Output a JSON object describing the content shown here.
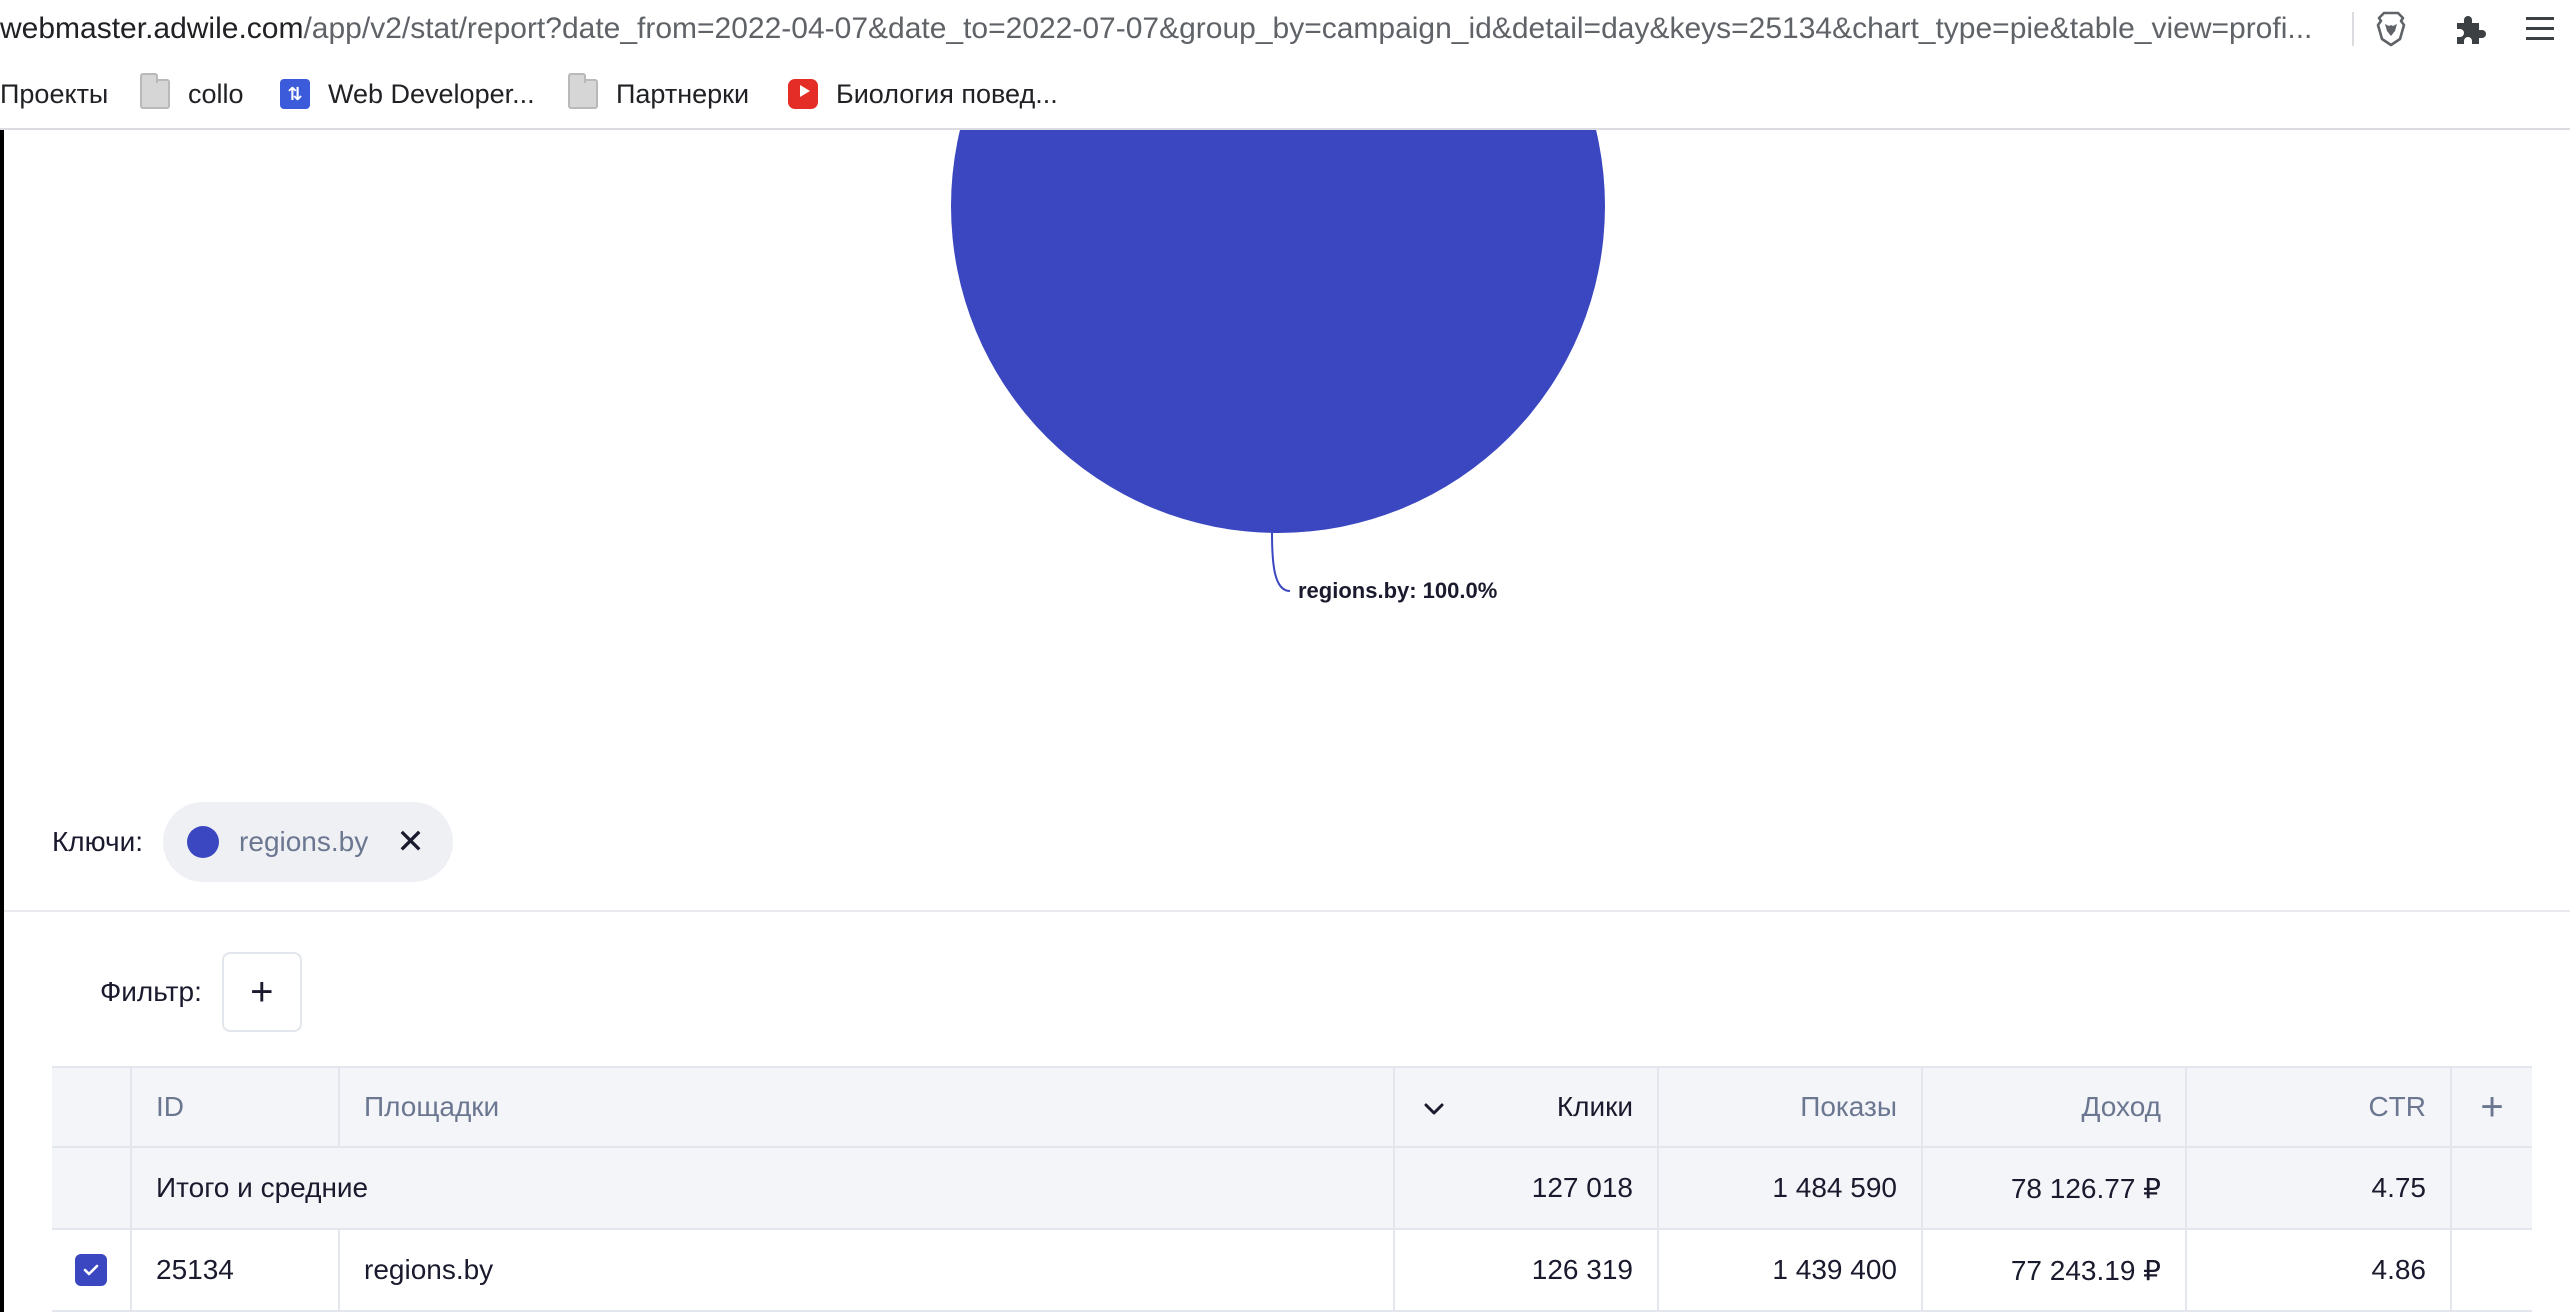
{
  "browser": {
    "url_host": "webmaster.adwile.com",
    "url_path": "/app/v2/stat/report?date_from=2022-04-07&date_to=2022-07-07&group_by=campaign_id&detail=day&keys=25134&chart_type=pie&table_view=profi...",
    "bookmarks": [
      {
        "label": "Проекты",
        "icon": "none"
      },
      {
        "label": "collo",
        "icon": "folder-icon"
      },
      {
        "label": "Web Developer...",
        "icon": "web-developer-icon"
      },
      {
        "label": "Партнерки",
        "icon": "folder-icon"
      },
      {
        "label": "Биология повед...",
        "icon": "youtube-icon"
      }
    ]
  },
  "chart_data": {
    "type": "pie",
    "slices": [
      {
        "label": "regions.by",
        "value": 100.0,
        "color": "#3b47c0"
      }
    ],
    "data_label": "regions.by: 100.0%"
  },
  "keys": {
    "label": "Ключи:",
    "chips": [
      {
        "label": "regions.by",
        "color": "#3b47c0"
      }
    ]
  },
  "filter": {
    "label": "Фильтр:",
    "add_label": "+"
  },
  "table": {
    "headers": {
      "id": "ID",
      "site": "Площадки",
      "clicks": "Клики",
      "shows": "Показы",
      "income": "Доход",
      "ctr": "CTR",
      "add": "+"
    },
    "total": {
      "label": "Итого и средние",
      "clicks": "127 018",
      "shows": "1 484 590",
      "income": "78 126.77 ₽",
      "ctr": "4.75"
    },
    "rows": [
      {
        "checked": true,
        "id": "25134",
        "site": "regions.by",
        "clicks": "126 319",
        "shows": "1 439 400",
        "income": "77 243.19 ₽",
        "ctr": "4.86"
      }
    ]
  }
}
